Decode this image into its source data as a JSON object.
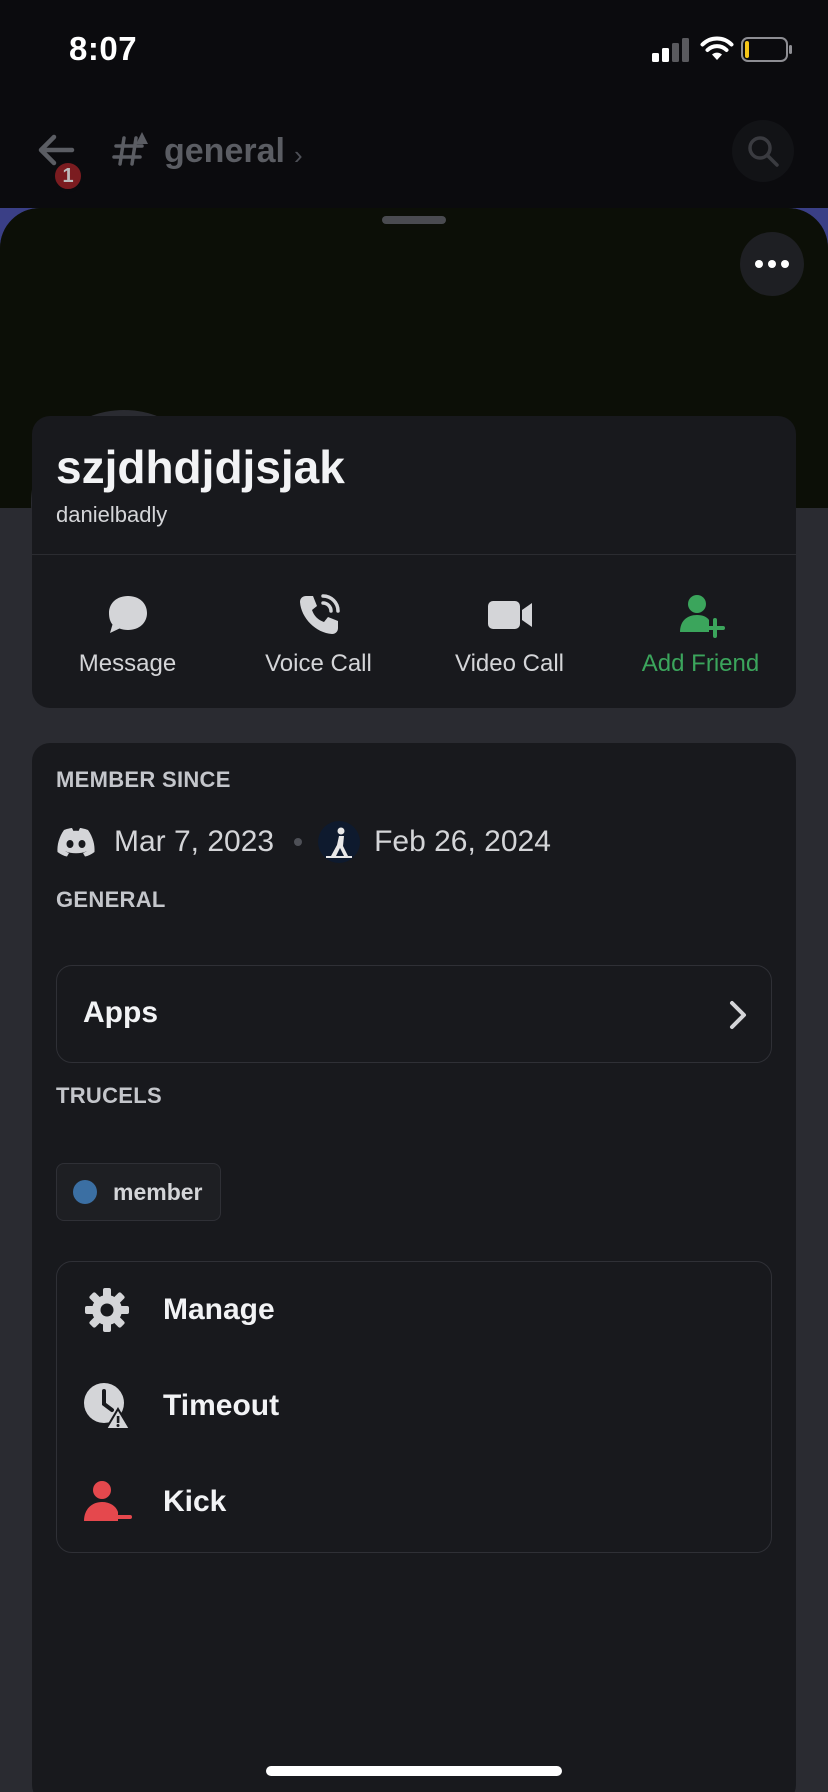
{
  "status_bar": {
    "time": "8:07"
  },
  "channel_header": {
    "channel_name": "general",
    "unread_badge": "1",
    "chevron": "›"
  },
  "profile": {
    "display_name": "szjdhdjdjsjak",
    "username": "danielbadly",
    "presence": "offline",
    "actions": [
      {
        "label": "Message",
        "icon": "chat-bubble-icon"
      },
      {
        "label": "Voice Call",
        "icon": "phone-icon"
      },
      {
        "label": "Video Call",
        "icon": "video-camera-icon"
      },
      {
        "label": "Add Friend",
        "icon": "add-friend-icon",
        "color": "#3ba55c"
      }
    ]
  },
  "member_since": {
    "title": "MEMBER SINCE",
    "discord_date": "Mar 7, 2023",
    "server_date": "Feb 26, 2024"
  },
  "general": {
    "title": "GENERAL",
    "apps_label": "Apps"
  },
  "roles": {
    "title": "TRUCELS",
    "items": [
      {
        "name": "member",
        "color": "#3b6fa3"
      }
    ]
  },
  "admin": {
    "items": [
      {
        "label": "Manage",
        "icon": "gear-icon"
      },
      {
        "label": "Timeout",
        "icon": "clock-warning-icon"
      },
      {
        "label": "Kick",
        "icon": "kick-user-icon",
        "color": "#e5484d"
      }
    ]
  },
  "colors": {
    "accent_green": "#3ba55c",
    "danger_red": "#e5484d",
    "sheet_bg": "#2a2b31",
    "card_bg": "#18191d"
  }
}
